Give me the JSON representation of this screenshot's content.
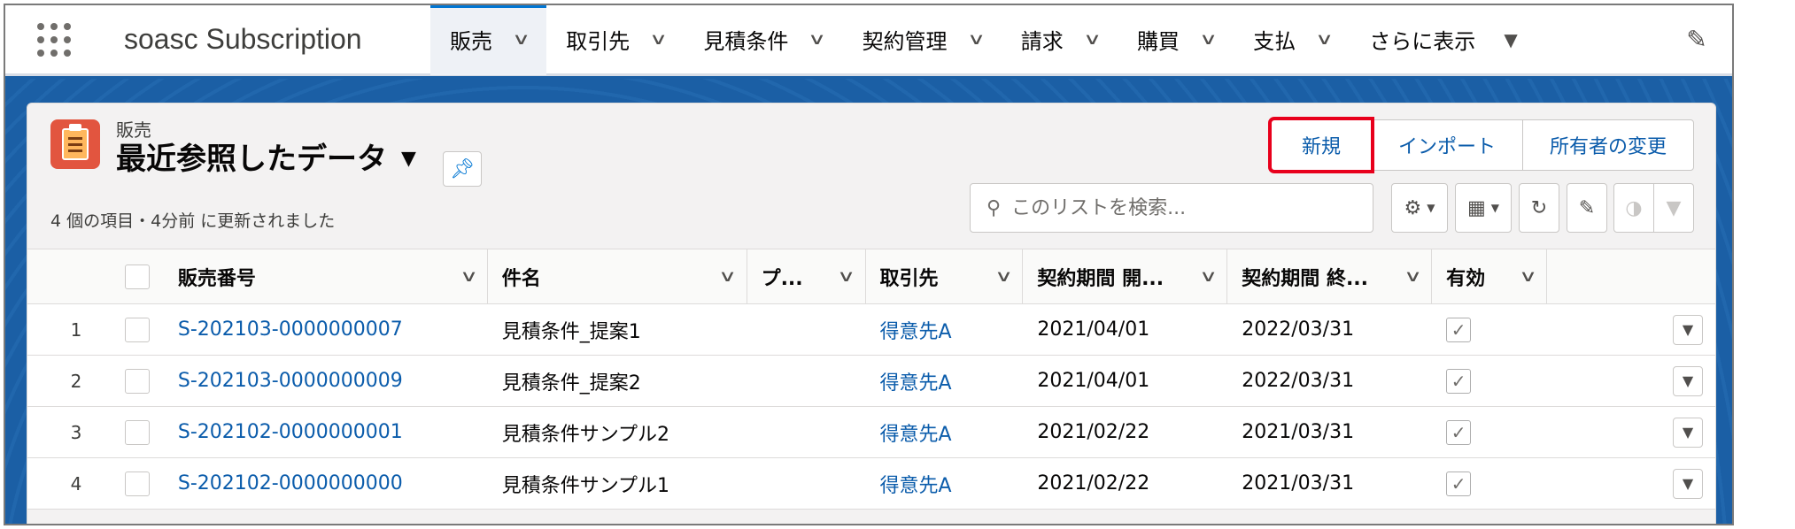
{
  "app": {
    "name": "soasc Subscription"
  },
  "nav": {
    "items": [
      {
        "label": "販売",
        "active": true
      },
      {
        "label": "取引先"
      },
      {
        "label": "見積条件"
      },
      {
        "label": "契約管理"
      },
      {
        "label": "請求"
      },
      {
        "label": "購買"
      },
      {
        "label": "支払"
      }
    ],
    "more_label": "さらに表示"
  },
  "list": {
    "object_label": "販売",
    "view_title": "最近参照したデータ",
    "status": "4 個の項目・4分前 に更新されました"
  },
  "actions": {
    "new_label": "新規",
    "import_label": "インポート",
    "change_owner_label": "所有者の変更"
  },
  "search": {
    "placeholder": "このリストを検索..."
  },
  "columns": {
    "sales_number": "販売番号",
    "name": "件名",
    "pu": "プ...",
    "account": "取引先",
    "start": "契約期間 開...",
    "end": "契約期間 終...",
    "active": "有効"
  },
  "rows": [
    {
      "num": "1",
      "sales_number": "S-202103-0000000007",
      "name": "見積条件_提案1",
      "account": "得意先A",
      "start": "2021/04/01",
      "end": "2022/03/31",
      "active": true
    },
    {
      "num": "2",
      "sales_number": "S-202103-0000000009",
      "name": "見積条件_提案2",
      "account": "得意先A",
      "start": "2021/04/01",
      "end": "2022/03/31",
      "active": true
    },
    {
      "num": "3",
      "sales_number": "S-202102-0000000001",
      "name": "見積条件サンプル2",
      "account": "得意先A",
      "start": "2021/02/22",
      "end": "2021/03/31",
      "active": true
    },
    {
      "num": "4",
      "sales_number": "S-202102-0000000000",
      "name": "見積条件サンプル1",
      "account": "得意先A",
      "start": "2021/02/22",
      "end": "2021/03/31",
      "active": true
    }
  ],
  "colors": {
    "brand": "#0176d3",
    "highlight": "#e8001c",
    "link": "#0b5cab",
    "icon_bg": "#e2553f"
  }
}
